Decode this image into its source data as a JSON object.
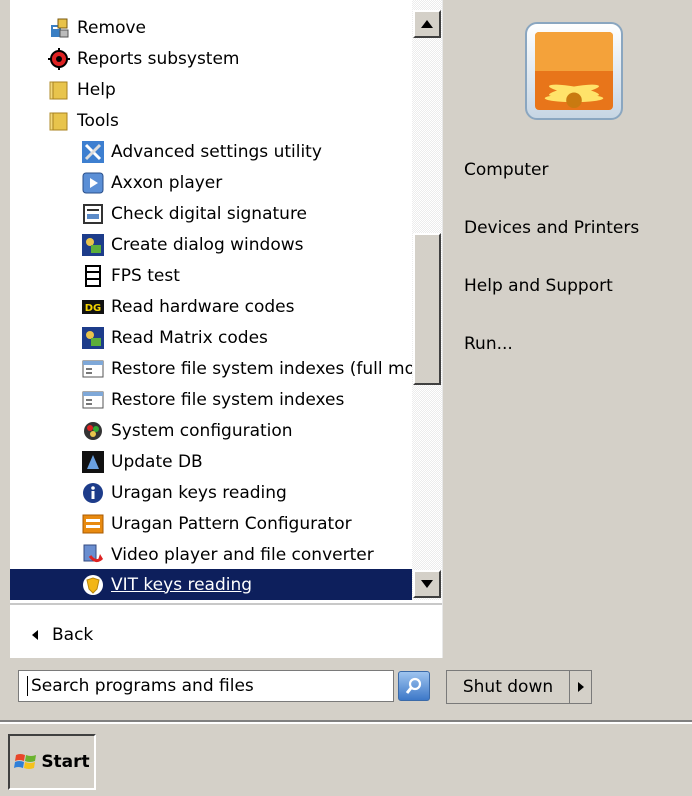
{
  "programs": {
    "items": [
      {
        "label": "Remove",
        "icon": "remove-icon"
      },
      {
        "label": "Reports subsystem",
        "icon": "reports-icon"
      },
      {
        "label": "Help",
        "icon": "folder-icon"
      },
      {
        "label": "Tools",
        "icon": "folder-icon"
      },
      {
        "label": "Advanced settings utility",
        "icon": "wrench-screwdriver-icon"
      },
      {
        "label": "Axxon player",
        "icon": "player-icon"
      },
      {
        "label": "Check digital signature",
        "icon": "signature-icon"
      },
      {
        "label": "Create dialog windows",
        "icon": "dialog-icon"
      },
      {
        "label": "FPS test",
        "icon": "film-icon"
      },
      {
        "label": "Read hardware codes",
        "icon": "hardware-codes-icon"
      },
      {
        "label": "Read Matrix codes",
        "icon": "matrix-icon"
      },
      {
        "label": "Restore file system indexes (full mod",
        "icon": "window-icon"
      },
      {
        "label": "Restore file system indexes",
        "icon": "window-icon"
      },
      {
        "label": "System configuration",
        "icon": "system-config-icon"
      },
      {
        "label": "Update DB",
        "icon": "update-db-icon"
      },
      {
        "label": "Uragan keys reading",
        "icon": "info-icon"
      },
      {
        "label": "Uragan Pattern Configurator",
        "icon": "pattern-icon"
      },
      {
        "label": "Video player and file converter",
        "icon": "video-converter-icon"
      },
      {
        "label": "VIT keys reading",
        "icon": "vit-shield-icon"
      }
    ],
    "selected": "VIT keys reading"
  },
  "back": {
    "label": "Back"
  },
  "right_links": [
    "Computer",
    "Devices and Printers",
    "Help and Support",
    "Run..."
  ],
  "search": {
    "placeholder": "Search programs and files"
  },
  "shutdown": {
    "label": "Shut down"
  },
  "taskbar": {
    "start_label": "Start"
  },
  "colors": {
    "selection": "#0d1f5c",
    "menu_bg": "#d4d0c8"
  }
}
